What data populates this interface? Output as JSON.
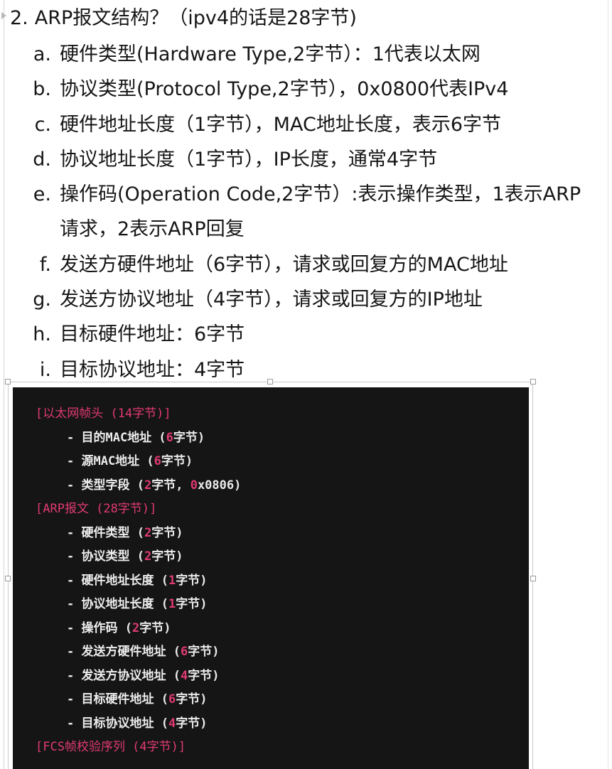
{
  "heading": {
    "number": "2.",
    "text": "ARP报文结构？（ipv4的话是28字节)"
  },
  "items": [
    {
      "marker": "a.",
      "text": "硬件类型(Hardware Type,2字节）：1代表以太网"
    },
    {
      "marker": "b.",
      "text": "协议类型(Protocol Type,2字节），0x0800代表IPv4"
    },
    {
      "marker": "c.",
      "text": "硬件地址长度（1字节），MAC地址长度，表示6字节"
    },
    {
      "marker": "d.",
      "text": "协议地址长度（1字节），IP长度，通常4字节"
    },
    {
      "marker": "e.",
      "text": "操作码(Operation Code,2字节）:表示操作类型，1表示ARP",
      "text2": "请求，2表示ARP回复"
    },
    {
      "marker": "f.",
      "text": "发送方硬件地址（6字节），请求或回复方的MAC地址"
    },
    {
      "marker": "g.",
      "text": "发送方协议地址（4字节），请求或回复方的IP地址"
    },
    {
      "marker": "h.",
      "text": "目标硬件地址：6字节"
    },
    {
      "marker": "i.",
      "text": "目标协议地址：4字节"
    }
  ],
  "code": {
    "sections": [
      {
        "header": "[以太网帧头 (14字节)]",
        "lines": [
          [
            "- 目的MAC地址 (",
            "6",
            "字节)"
          ],
          [
            "- 源MAC地址 (",
            "6",
            "字节)"
          ],
          [
            "- 类型字段 (",
            "2",
            "字节, ",
            "0",
            "x0806)"
          ]
        ]
      },
      {
        "header": "[ARP报文 (28字节)]",
        "lines": [
          [
            "- 硬件类型 (",
            "2",
            "字节)"
          ],
          [
            "- 协议类型 (",
            "2",
            "字节)"
          ],
          [
            "- 硬件地址长度 (",
            "1",
            "字节)"
          ],
          [
            "- 协议地址长度 (",
            "1",
            "字节)"
          ],
          [
            "- 操作码 (",
            "2",
            "字节)"
          ],
          [
            "- 发送方硬件地址 (",
            "6",
            "字节)"
          ],
          [
            "- 发送方协议地址 (",
            "4",
            "字节)"
          ],
          [
            "- 目标硬件地址 (",
            "6",
            "字节)"
          ],
          [
            "- 目标协议地址 (",
            "4",
            "字节)"
          ]
        ]
      },
      {
        "header": "[FCS帧校验序列 (4字节)]",
        "lines": []
      }
    ]
  },
  "colors": {
    "code_background": "#151515",
    "code_accent": "#e03a72",
    "code_text": "#ececec"
  }
}
